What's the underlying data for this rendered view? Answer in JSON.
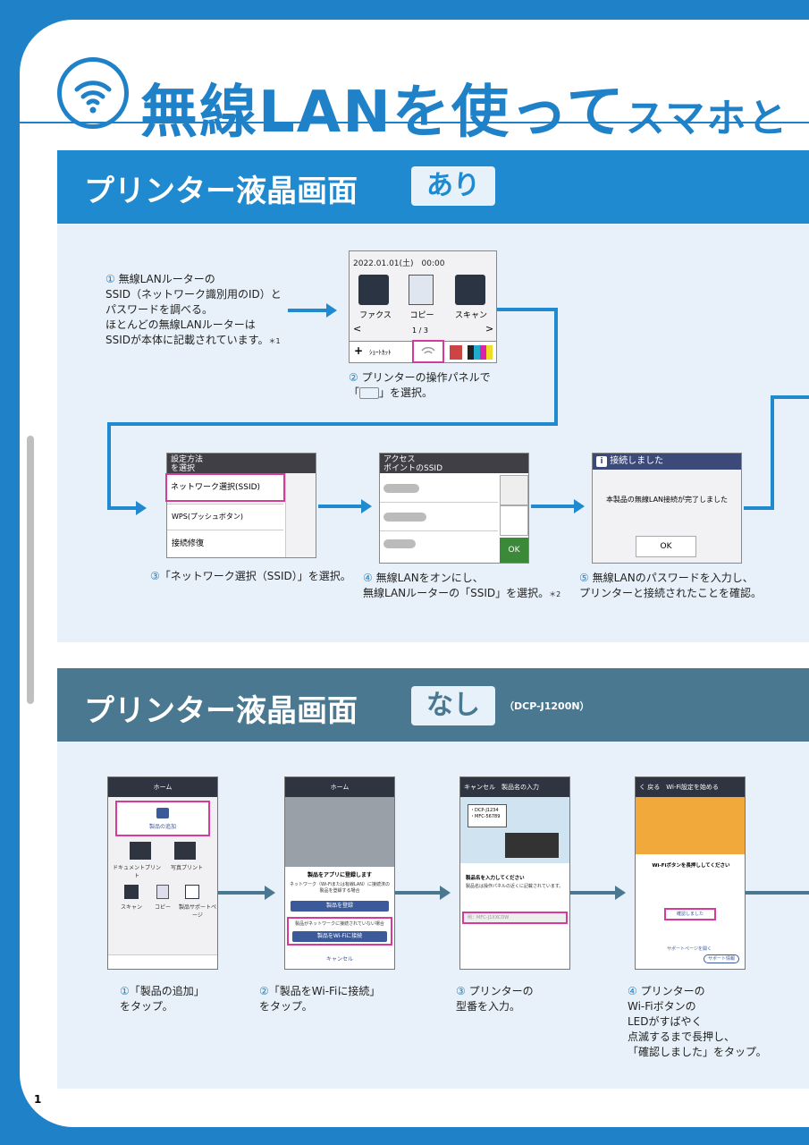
{
  "header": {
    "title_main": "無線LANを使って",
    "title_sub": "スマホと",
    "icon": "wifi-icon"
  },
  "section1": {
    "title": "プリンター液晶画面",
    "tag": "あり",
    "step1": {
      "num": "①",
      "lines": [
        "無線LANルーターの",
        "SSID（ネットワーク識別用のID）と",
        "パスワードを調べる。",
        "ほとんどの無線LANルーターは",
        "SSIDが本体に記載されています。"
      ],
      "note": "＊1"
    },
    "lcd_home": {
      "datetime": "2022.01.01(土)　00:00",
      "apps": [
        "ファクス",
        "コピー",
        "スキャン"
      ],
      "page": "1 / 3",
      "prev": "<",
      "next": ">",
      "shortcut_plus": "+",
      "shortcut": "ｼｮｰﾄｶｯﾄ"
    },
    "step2": {
      "num": "②",
      "line1": "プリンターの操作パネルで",
      "line2a": "「",
      "line2b": "」を選択。"
    },
    "lcd_menu": {
      "header_l1": "設定方法",
      "header_l2": "を選択",
      "items": [
        "ネットワーク選択(SSID)",
        "WPS(プッシュボタン)",
        "接続修復"
      ]
    },
    "step3": {
      "num": "③",
      "text": "「ネットワーク選択（SSID）」を選択。"
    },
    "lcd_ssid": {
      "header_l1": "アクセス",
      "header_l2": "ポイントのSSID",
      "ok": "OK"
    },
    "step4": {
      "num": "④",
      "line1": "無線LANをオンにし、",
      "line2": "無線LANルーターの「SSID」を選択。",
      "note": "＊2"
    },
    "lcd_done": {
      "info": "i",
      "header": "接続しました",
      "message": "本製品の無線LAN接続が完了しました",
      "ok": "OK"
    },
    "step5": {
      "num": "⑤",
      "line1": "無線LANのパスワードを入力し、",
      "line2": "プリンターと接続されたことを確認。"
    }
  },
  "section2": {
    "title": "プリンター液晶画面",
    "tag": "なし",
    "model": "（DCP-J1200N）",
    "phone1": {
      "bar": "ホーム",
      "add": "製品の追加",
      "grid": [
        "ドキュメントプリント",
        "写真プリント",
        "スキャン",
        "コピー",
        "製品サポートページ"
      ]
    },
    "phone2": {
      "bar": "ホーム",
      "dialog_title": "製品をアプリに登録します",
      "dialog_text": "ネットワーク（Wi-Fiまたは有線LAN）に接続済の製品を登録する場合",
      "btn1": "製品を登録",
      "dialog_text2": "製品がネットワークに接続されていない場合",
      "btn2": "製品をWi-Fiに接続",
      "cancel": "キャンセル"
    },
    "phone3": {
      "bar_l": "キャンセル",
      "bar_c": "製品名の入力",
      "models": [
        "・DCP-J1234",
        "・MFC-56789"
      ],
      "heading": "製品名を入力してください",
      "body": "製品名は操作パネルの近くに記載されています。",
      "input": "例：MFC-J1XXCDW"
    },
    "phone4": {
      "bar_l": "く 戻る",
      "bar_c": "Wi-Fi設定を始める",
      "heading": "Wi-Fiボタンを長押ししてください",
      "confirm": "確認しました",
      "support_link": "サポートページを開く",
      "support_btn": "サポート情報"
    },
    "steps": [
      {
        "num": "①",
        "lines": [
          "「製品の追加」",
          "をタップ。"
        ]
      },
      {
        "num": "②",
        "lines": [
          "「製品をWi-Fiに接続」",
          "をタップ。"
        ]
      },
      {
        "num": "③",
        "lines": [
          "プリンターの",
          "型番を入力。"
        ]
      },
      {
        "num": "④",
        "lines": [
          "プリンターの",
          "Wi-Fiボタンの",
          "LEDがすばやく",
          "点滅するまで長押し、",
          "「確認しました」をタップ。"
        ]
      }
    ]
  },
  "footer": {
    "page_number": "1"
  },
  "colors": {
    "brand": "#1f82c8",
    "highlight": "#d63b9c",
    "section2": "#4a7890"
  }
}
